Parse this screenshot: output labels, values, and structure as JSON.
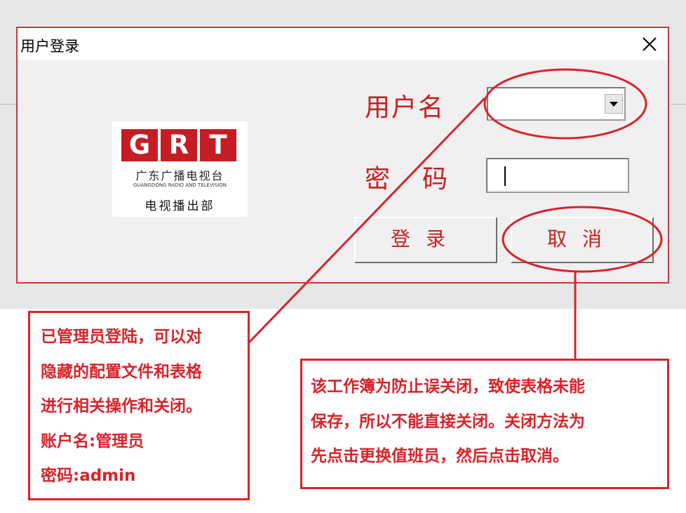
{
  "dialog": {
    "title": "用户登录",
    "close_icon": "close-icon"
  },
  "logo": {
    "letters": [
      "G",
      "R",
      "T"
    ],
    "chinese_name": "广东广播电视台",
    "english_name": "GUANGDONG RADIO AND TELEVISION",
    "department": "电视播出部"
  },
  "form": {
    "username_label": "用户名",
    "username_value": "",
    "password_label": "密码",
    "password_value": ""
  },
  "buttons": {
    "login_label": "登录",
    "cancel_label": "取消"
  },
  "annotations": {
    "left_note": {
      "lines": [
        "已管理员登陆，可以对",
        "隐藏的配置文件和表格",
        "进行相关操作和关闭。",
        "账户名:管理员",
        "密码:admin"
      ]
    },
    "right_note": {
      "lines": [
        "该工作簿为防止误关闭，致使表格未能",
        "保存，所以不能直接关闭。关闭方法为",
        "先点击更换值班员，然后点击取消。"
      ]
    },
    "color": "#d8232a"
  },
  "colors": {
    "accent_red": "#c8201f",
    "dialog_border": "#c8393d",
    "dialog_bg": "#f0f0f0",
    "logo_red": "#c41e24"
  }
}
